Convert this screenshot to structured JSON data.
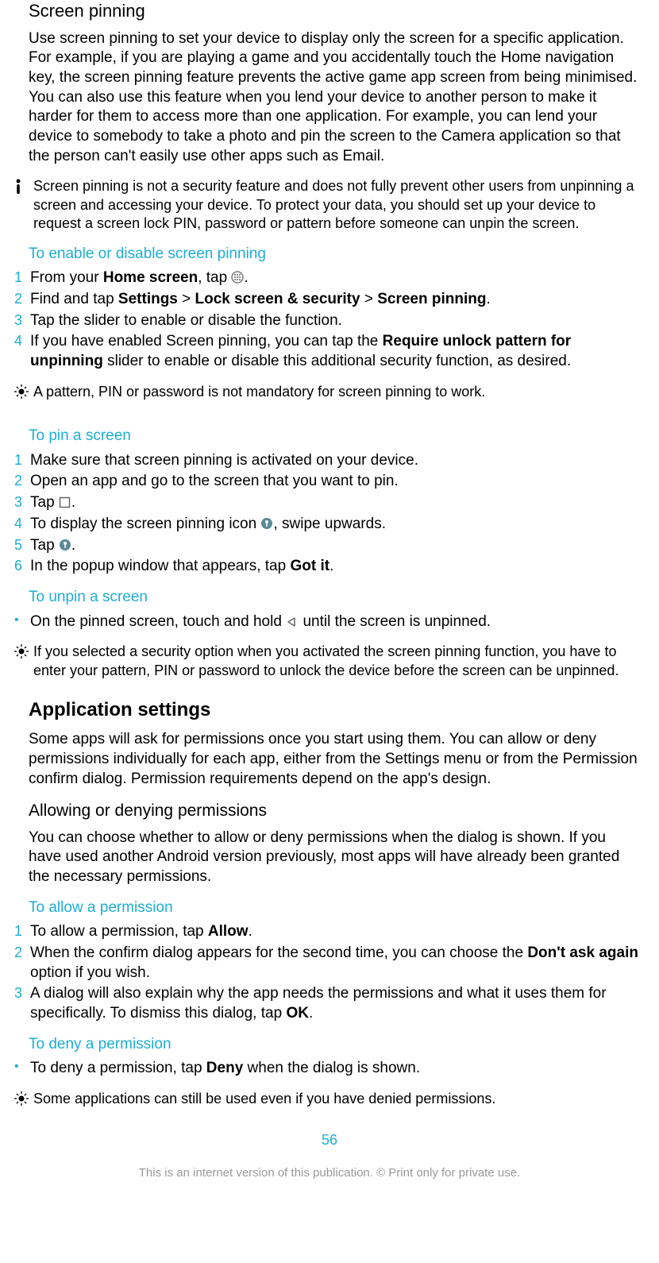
{
  "screenPinning": {
    "title": "Screen pinning",
    "intro": "Use screen pinning to set your device to display only the screen for a specific application. For example, if you are playing a game and you accidentally touch the Home navigation key, the screen pinning feature prevents the active game app screen from being minimised. You can also use this feature when you lend your device to another person to make it harder for them to access more than one application. For example, you can lend your device to somebody to take a photo and pin the screen to the Camera application so that the person can't easily use other apps such as Email.",
    "warning": "Screen pinning is not a security feature and does not fully prevent other users from unpinning a screen and accessing your device. To protect your data, you should set up your device to request a screen lock PIN, password or pattern before someone can unpin the screen.",
    "enable": {
      "heading": "To enable or disable screen pinning",
      "steps": {
        "s1a": "From your ",
        "s1b": "Home screen",
        "s1c": ", tap ",
        "s1d": ".",
        "s2a": "Find and tap ",
        "s2b": "Settings",
        "s2c": " > ",
        "s2d": "Lock screen & security",
        "s2e": " > ",
        "s2f": "Screen pinning",
        "s2g": ".",
        "s3": "Tap the slider to enable or disable the function.",
        "s4a": "If you have enabled Screen pinning, you can tap the ",
        "s4b": "Require unlock pattern for unpinning",
        "s4c": " slider to enable or disable this additional security function, as desired."
      },
      "tip": "A pattern, PIN or password is not mandatory for screen pinning to work."
    },
    "pin": {
      "heading": "To pin a screen",
      "steps": {
        "s1": "Make sure that screen pinning is activated on your device.",
        "s2": "Open an app and go to the screen that you want to pin.",
        "s3a": "Tap ",
        "s3b": ".",
        "s4a": "To display the screen pinning icon ",
        "s4b": ", swipe upwards.",
        "s5a": "Tap ",
        "s5b": ".",
        "s6a": "In the popup window that appears, tap ",
        "s6b": "Got it",
        "s6c": "."
      }
    },
    "unpin": {
      "heading": "To unpin a screen",
      "step": {
        "a": "On the pinned screen, touch and hold ",
        "b": " until the screen is unpinned."
      },
      "tip": "If you selected a security option when you activated the screen pinning function, you have to enter your pattern, PIN or password to unlock the device before the screen can be unpinned."
    }
  },
  "appSettings": {
    "title": "Application settings",
    "intro": "Some apps will ask for permissions once you start using them. You can allow or deny permissions individually for each app, either from the Settings menu or from the Permission confirm dialog. Permission requirements depend on the app's design.",
    "allowDeny": {
      "heading": "Allowing or denying permissions",
      "intro": "You can choose whether to allow or deny permissions when the dialog is shown. If you have used another Android version previously, most apps will have already been granted the necessary permissions."
    },
    "allow": {
      "heading": "To allow a permission",
      "steps": {
        "s1a": "To allow a permission, tap ",
        "s1b": "Allow",
        "s1c": ".",
        "s2a": "When the confirm dialog appears for the second time, you can choose the ",
        "s2b": "Don't ask again",
        "s2c": " option if you wish.",
        "s3a": "A dialog will also explain why the app needs the permissions and what it uses them for specifically. To dismiss this dialog, tap ",
        "s3b": "OK",
        "s3c": "."
      }
    },
    "deny": {
      "heading": "To deny a permission",
      "step": {
        "a": "To deny a permission, tap ",
        "b": "Deny",
        "c": " when the dialog is shown."
      },
      "tip": "Some applications can still be used even if you have denied permissions."
    }
  },
  "pageNumber": "56",
  "footer": "This is an internet version of this publication. © Print only for private use."
}
